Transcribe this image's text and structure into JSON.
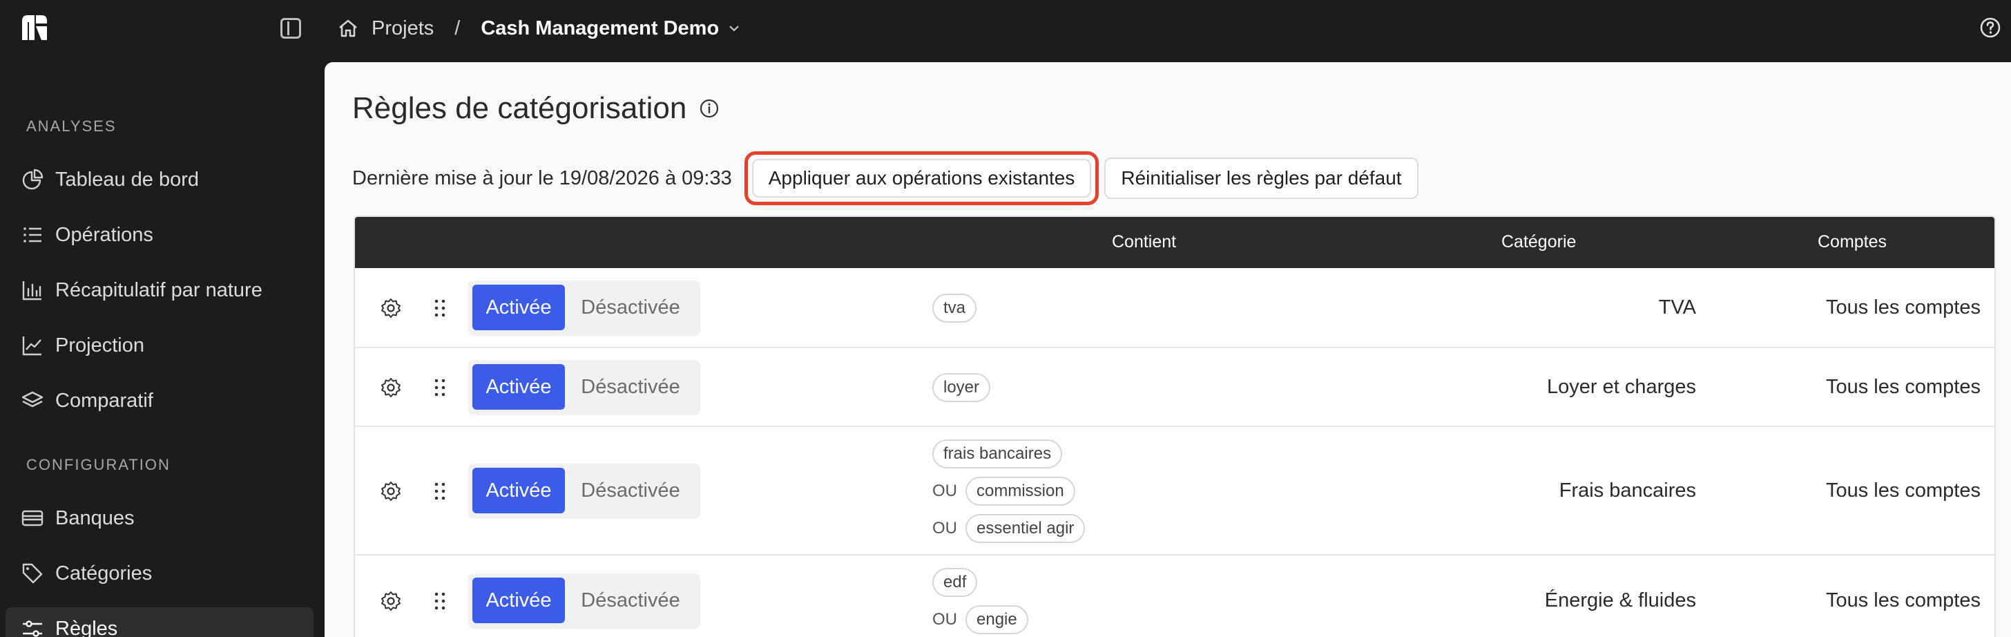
{
  "topbar": {
    "breadcrumb_root": "Projets",
    "breadcrumb_separator": "/",
    "breadcrumb_current": "Cash Management Demo"
  },
  "sidebar": {
    "section_analyses": "ANALYSES",
    "section_config": "CONFIGURATION",
    "items": [
      {
        "label": "Tableau de bord",
        "icon": "pie-chart-icon"
      },
      {
        "label": "Opérations",
        "icon": "list-icon"
      },
      {
        "label": "Récapitulatif par nature",
        "icon": "bar-chart-icon"
      },
      {
        "label": "Projection",
        "icon": "line-chart-icon"
      },
      {
        "label": "Comparatif",
        "icon": "layers-icon"
      },
      {
        "label": "Banques",
        "icon": "card-icon"
      },
      {
        "label": "Catégories",
        "icon": "tag-icon"
      },
      {
        "label": "Règles",
        "icon": "sliders-icon",
        "active": true
      }
    ]
  },
  "main": {
    "title": "Règles de catégorisation",
    "updated_text": "Dernière mise à jour le 19/08/2026 à 09:33",
    "apply_button": "Appliquer aux opérations existantes",
    "reset_button": "Réinitialiser les règles par défaut"
  },
  "table": {
    "columns": {
      "contient": "Contient",
      "categorie": "Catégorie",
      "comptes": "Comptes"
    },
    "toggle_on": "Activée",
    "toggle_off": "Désactivée",
    "or_label": "OU",
    "rows": [
      {
        "keywords": [
          "tva"
        ],
        "category": "TVA",
        "accounts": "Tous les comptes"
      },
      {
        "keywords": [
          "loyer"
        ],
        "category": "Loyer et charges",
        "accounts": "Tous les comptes"
      },
      {
        "keywords": [
          "frais bancaires",
          "commission",
          "essentiel agir"
        ],
        "category": "Frais bancaires",
        "accounts": "Tous les comptes"
      },
      {
        "keywords": [
          "edf",
          "engie"
        ],
        "category": "Énergie & fluides",
        "accounts": "Tous les comptes"
      }
    ]
  },
  "colors": {
    "accent": "#3b5ce8",
    "highlight": "#e5412c",
    "dark": "#1c1c1c"
  }
}
